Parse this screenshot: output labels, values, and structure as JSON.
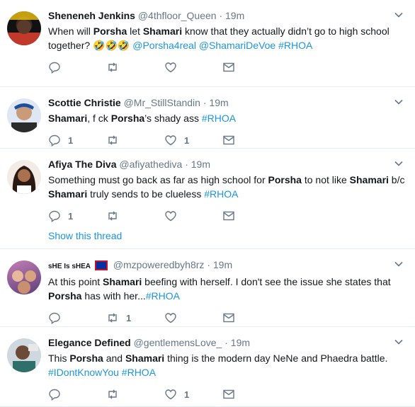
{
  "tweets": [
    {
      "name": "Sheneneh Jenkins",
      "handle": "@4thfloor_Queen",
      "dot": "·",
      "time": "19m",
      "segments": [
        {
          "t": "When will "
        },
        {
          "t": "Porsha",
          "c": "hl"
        },
        {
          "t": " let "
        },
        {
          "t": "Shamari",
          "c": "hl"
        },
        {
          "t": " know that they actually didn’t go to high school together? 🤣🤣🤣 "
        },
        {
          "t": "@Porsha4real",
          "c": "mention"
        },
        {
          "t": " "
        },
        {
          "t": "@ShamariDeVoe",
          "c": "mention"
        },
        {
          "t": " "
        },
        {
          "t": "#RHOA",
          "c": "tag"
        }
      ],
      "replies": "",
      "retweets": "",
      "likes": ""
    },
    {
      "name": "Scottie Christie",
      "handle": "@Mr_StillStandin",
      "dot": "·",
      "time": "19m",
      "segments": [
        {
          "t": "Shamari",
          "c": "hl"
        },
        {
          "t": ", f  ck "
        },
        {
          "t": "Porsha",
          "c": "hl"
        },
        {
          "t": "’s shady ass "
        },
        {
          "t": "#RHOA",
          "c": "tag"
        }
      ],
      "replies": "1",
      "retweets": "",
      "likes": "1"
    },
    {
      "name": "Afiya The Diva",
      "handle": "@afiyathediva",
      "dot": "·",
      "time": "19m",
      "segments": [
        {
          "t": "Something must go back as far as high school for "
        },
        {
          "t": "Porsha",
          "c": "hl"
        },
        {
          "t": " to not like "
        },
        {
          "t": "Shamari",
          "c": "hl"
        },
        {
          "t": " b/c "
        },
        {
          "t": "Shamari",
          "c": "hl"
        },
        {
          "t": " truly sends to be clueless "
        },
        {
          "t": "#RHOA",
          "c": "tag"
        }
      ],
      "replies": "1",
      "retweets": "",
      "likes": "",
      "show_thread": "Show this thread"
    },
    {
      "name": "sHE Is sHEA",
      "handle": "@mzpoweredbyh8rz",
      "dot": "·",
      "time": "19m",
      "segments": [
        {
          "t": "At this point "
        },
        {
          "t": "Shamari",
          "c": "hl"
        },
        {
          "t": " beefing with herself. I don't see the issue she states that "
        },
        {
          "t": "Porsha",
          "c": "hl"
        },
        {
          "t": " has with her..."
        },
        {
          "t": "#RHOA",
          "c": "tag"
        }
      ],
      "replies": "",
      "retweets": "1",
      "likes": ""
    },
    {
      "name": "Elegance Defined",
      "handle": "@gentlemensLove_",
      "dot": "·",
      "time": "19m",
      "segments": [
        {
          "t": "This "
        },
        {
          "t": "Porsha",
          "c": "hl"
        },
        {
          "t": " and "
        },
        {
          "t": "Shamari",
          "c": "hl"
        },
        {
          "t": " thing is the modern day NeNe and Phaedra battle. "
        },
        {
          "t": "#IDontKnowYou",
          "c": "tag"
        },
        {
          "t": " "
        },
        {
          "t": "#RHOA",
          "c": "tag"
        }
      ],
      "replies": "",
      "retweets": "",
      "likes": "1"
    }
  ],
  "icons": {
    "reply": "reply-icon",
    "retweet": "retweet-icon",
    "like": "heart-icon",
    "dm": "envelope-icon",
    "more": "chevron-down-icon"
  },
  "colors": {
    "link": "#1b95e0",
    "secondary": "#657786",
    "text": "#14171a",
    "divider": "#e6ecf0"
  }
}
